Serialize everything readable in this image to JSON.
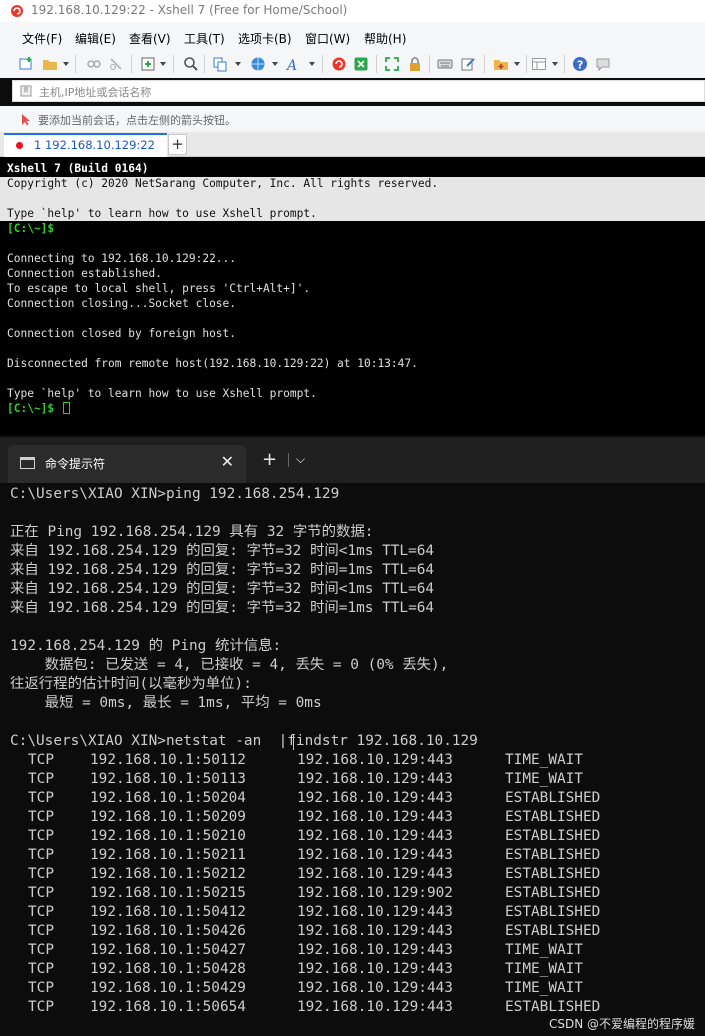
{
  "xshell": {
    "title": "192.168.10.129:22 - Xshell 7 (Free for Home/School)",
    "menu": [
      "文件(F)",
      "编辑(E)",
      "查看(V)",
      "工具(T)",
      "选项卡(B)",
      "窗口(W)",
      "帮助(H)"
    ],
    "address_placeholder": "主机,IP地址或会话名称",
    "hint": "要添加当前会话，点击左侧的箭头按钮。",
    "tab_label": "1 192.168.10.129:22",
    "new_tab": "+",
    "terminal": {
      "build_line": "Xshell 7 (Build 0164)",
      "copyright": "Copyright (c) 2020 NetSarang Computer, Inc. All rights reserved.",
      "help1": "Type `help' to learn how to use Xshell prompt.",
      "prompt1": "[C:\\~]$",
      "connecting": "Connecting to 192.168.10.129:22...",
      "established": "Connection established.",
      "escape": "To escape to local shell, press 'Ctrl+Alt+]'.",
      "closing": "Connection closing...Socket close.",
      "closed": "Connection closed by foreign host.",
      "disconnected": "Disconnected from remote host(192.168.10.129:22) at 10:13:47.",
      "help2": "Type `help' to learn how to use Xshell prompt.",
      "prompt2": "[C:\\~]$ "
    }
  },
  "cmd": {
    "tab_label": "命令提示符",
    "close": "✕",
    "plus": "+",
    "chevron": "⌵",
    "ping_cmd": "C:\\Users\\XIAO XIN>ping 192.168.254.129",
    "ping_header": "正在 Ping 192.168.254.129 具有 32 字节的数据:",
    "replies": [
      "来自 192.168.254.129 的回复: 字节=32 时间<1ms TTL=64",
      "来自 192.168.254.129 的回复: 字节=32 时间=1ms TTL=64",
      "来自 192.168.254.129 的回复: 字节=32 时间<1ms TTL=64",
      "来自 192.168.254.129 的回复: 字节=32 时间=1ms TTL=64"
    ],
    "stats_header": "192.168.254.129 的 Ping 统计信息:",
    "stats_packets": "    数据包: 已发送 = 4, 已接收 = 4, 丢失 = 0 (0% 丢失),",
    "rtt_header": "往返行程的估计时间(以毫秒为单位):",
    "rtt_values": "    最短 = 0ms, 最长 = 1ms, 平均 = 0ms",
    "netstat_cmd": "C:\\Users\\XIAO XIN>netstat -an  |findstr 192.168.10.129",
    "netstat": [
      {
        "proto": "TCP",
        "local": "192.168.10.1:50112",
        "remote": "192.168.10.129:443",
        "state": "TIME_WAIT"
      },
      {
        "proto": "TCP",
        "local": "192.168.10.1:50113",
        "remote": "192.168.10.129:443",
        "state": "TIME_WAIT"
      },
      {
        "proto": "TCP",
        "local": "192.168.10.1:50204",
        "remote": "192.168.10.129:443",
        "state": "ESTABLISHED"
      },
      {
        "proto": "TCP",
        "local": "192.168.10.1:50209",
        "remote": "192.168.10.129:443",
        "state": "ESTABLISHED"
      },
      {
        "proto": "TCP",
        "local": "192.168.10.1:50210",
        "remote": "192.168.10.129:443",
        "state": "ESTABLISHED"
      },
      {
        "proto": "TCP",
        "local": "192.168.10.1:50211",
        "remote": "192.168.10.129:443",
        "state": "ESTABLISHED"
      },
      {
        "proto": "TCP",
        "local": "192.168.10.1:50212",
        "remote": "192.168.10.129:443",
        "state": "ESTABLISHED"
      },
      {
        "proto": "TCP",
        "local": "192.168.10.1:50215",
        "remote": "192.168.10.129:902",
        "state": "ESTABLISHED"
      },
      {
        "proto": "TCP",
        "local": "192.168.10.1:50412",
        "remote": "192.168.10.129:443",
        "state": "ESTABLISHED"
      },
      {
        "proto": "TCP",
        "local": "192.168.10.1:50426",
        "remote": "192.168.10.129:443",
        "state": "ESTABLISHED"
      },
      {
        "proto": "TCP",
        "local": "192.168.10.1:50427",
        "remote": "192.168.10.129:443",
        "state": "TIME_WAIT"
      },
      {
        "proto": "TCP",
        "local": "192.168.10.1:50428",
        "remote": "192.168.10.129:443",
        "state": "TIME_WAIT"
      },
      {
        "proto": "TCP",
        "local": "192.168.10.1:50429",
        "remote": "192.168.10.129:443",
        "state": "TIME_WAIT"
      },
      {
        "proto": "TCP",
        "local": "192.168.10.1:50654",
        "remote": "192.168.10.129:443",
        "state": "ESTABLISHED"
      }
    ]
  },
  "watermark": "CSDN @不爱编程的程序媛",
  "colors": {
    "prompt_green": "#2bd12b",
    "tab_accent": "#1a73e8",
    "session_dot": "#e81123"
  },
  "icons": [
    "xshell-logo-icon",
    "new-session-icon",
    "open-folder-icon",
    "link-icon",
    "unlink-icon",
    "properties-icon",
    "search-icon",
    "copy-icon",
    "globe-icon",
    "font-icon",
    "xshell-icon",
    "xftp-icon",
    "fullscreen-icon",
    "lock-icon",
    "keyboard-icon",
    "compose-icon",
    "add-folder-icon",
    "layout-icon",
    "help-icon",
    "chat-icon",
    "bookmark-icon",
    "add-session-arrow-icon",
    "cmd-window-icon"
  ]
}
